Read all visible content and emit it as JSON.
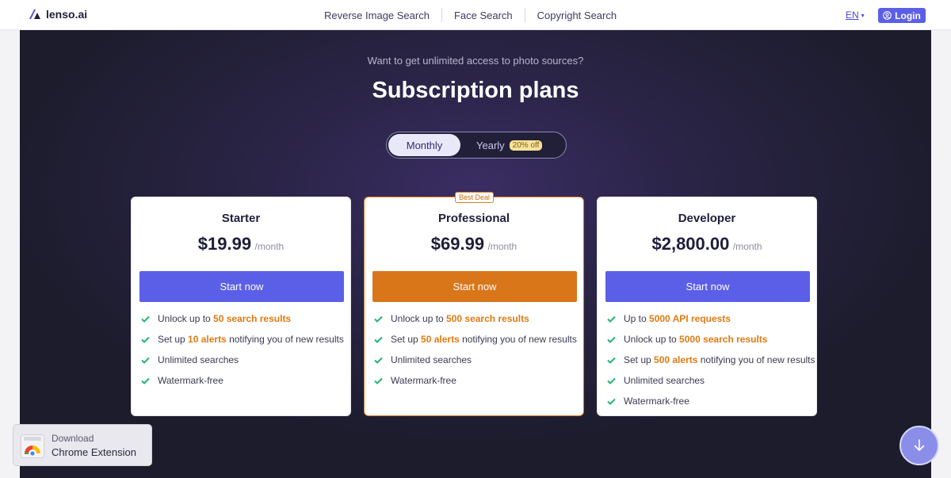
{
  "header": {
    "logo_text": "lenso.ai",
    "nav": [
      "Reverse Image Search",
      "Face Search",
      "Copyright Search"
    ],
    "language": "EN",
    "login_label": "Login"
  },
  "hero": {
    "eyebrow": "Want to get unlimited access to photo sources?",
    "title": "Subscription plans",
    "toggle": {
      "monthly_label": "Monthly",
      "yearly_label": "Yearly",
      "yearly_discount": "20% off",
      "selected": "Monthly"
    }
  },
  "plans": [
    {
      "name": "Starter",
      "price": "$19.99",
      "period": "/month",
      "cta": "Start now",
      "features": [
        {
          "pre": "Unlock up to ",
          "hl": "50 search results",
          "post": ""
        },
        {
          "pre": "Set up ",
          "hl": "10 alerts",
          "post": " notifying you of new results"
        },
        {
          "pre": "Unlimited searches",
          "hl": "",
          "post": ""
        },
        {
          "pre": "Watermark-free",
          "hl": "",
          "post": ""
        }
      ]
    },
    {
      "name": "Professional",
      "badge": "Best Deal",
      "price": "$69.99",
      "period": "/month",
      "cta": "Start now",
      "features": [
        {
          "pre": "Unlock up to ",
          "hl": "500 search results",
          "post": ""
        },
        {
          "pre": "Set up ",
          "hl": "50 alerts",
          "post": " notifying you of new results"
        },
        {
          "pre": "Unlimited searches",
          "hl": "",
          "post": ""
        },
        {
          "pre": "Watermark-free",
          "hl": "",
          "post": ""
        }
      ]
    },
    {
      "name": "Developer",
      "price": "$2,800.00",
      "period": "/month",
      "cta": "Start now",
      "features": [
        {
          "pre": "Up to ",
          "hl": "5000 API requests",
          "post": ""
        },
        {
          "pre": "Unlock up to ",
          "hl": "5000 search results",
          "post": ""
        },
        {
          "pre": "Set up ",
          "hl": "500 alerts",
          "post": " notifying you of new results"
        },
        {
          "pre": "Unlimited searches",
          "hl": "",
          "post": ""
        },
        {
          "pre": "Watermark-free",
          "hl": "",
          "post": ""
        }
      ]
    }
  ],
  "extension": {
    "line1": "Download",
    "line2": "Chrome Extension"
  },
  "colors": {
    "accent": "#5b5fe8",
    "featured": "#d9761a",
    "highlight": "#e07a12",
    "check": "#22b573"
  },
  "icons": {
    "logo": "lenso-logo-icon",
    "language_dropdown": "chevron-down-icon",
    "login": "user-circle-icon",
    "feature_check": "check-icon",
    "extension": "chrome-icon",
    "scroll_down": "arrow-down-icon"
  }
}
